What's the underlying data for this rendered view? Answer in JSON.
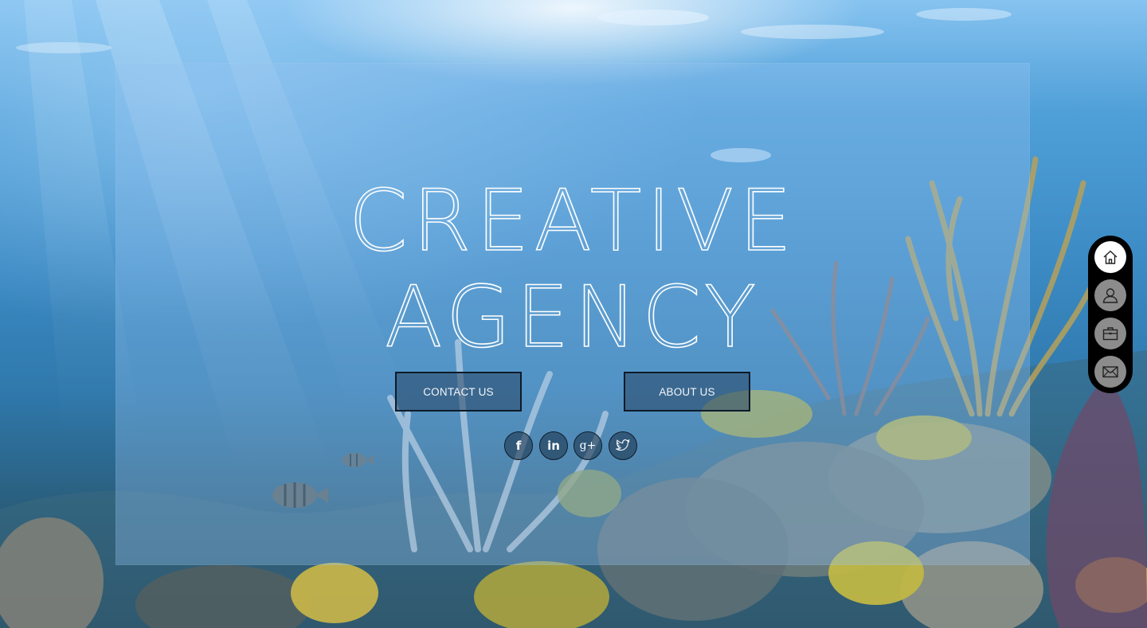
{
  "hero": {
    "title_line1": "CREATIVE",
    "title_line2": "AGENCY"
  },
  "buttons": {
    "contact_label": "CONTACT US",
    "about_label": "ABOUT US"
  },
  "social": [
    {
      "name": "facebook",
      "glyph": "f",
      "icon": "facebook-icon"
    },
    {
      "name": "linkedin",
      "glyph": "in",
      "icon": "linkedin-icon"
    },
    {
      "name": "google-plus",
      "glyph": "g+",
      "icon": "google-plus-icon"
    },
    {
      "name": "twitter",
      "glyph": "",
      "icon": "twitter-icon"
    }
  ],
  "sidenav": [
    {
      "name": "home",
      "icon": "home-icon",
      "active": true
    },
    {
      "name": "about",
      "icon": "user-icon",
      "active": false
    },
    {
      "name": "portfolio",
      "icon": "briefcase-icon",
      "active": false
    },
    {
      "name": "contact",
      "icon": "envelope-icon",
      "active": false
    }
  ],
  "colors": {
    "panel_tint": "#96c3f0",
    "button_border": "#0d1b2a",
    "nav_background": "#000000",
    "nav_active": "#ffffff",
    "nav_inactive": "#8c8c8c"
  }
}
